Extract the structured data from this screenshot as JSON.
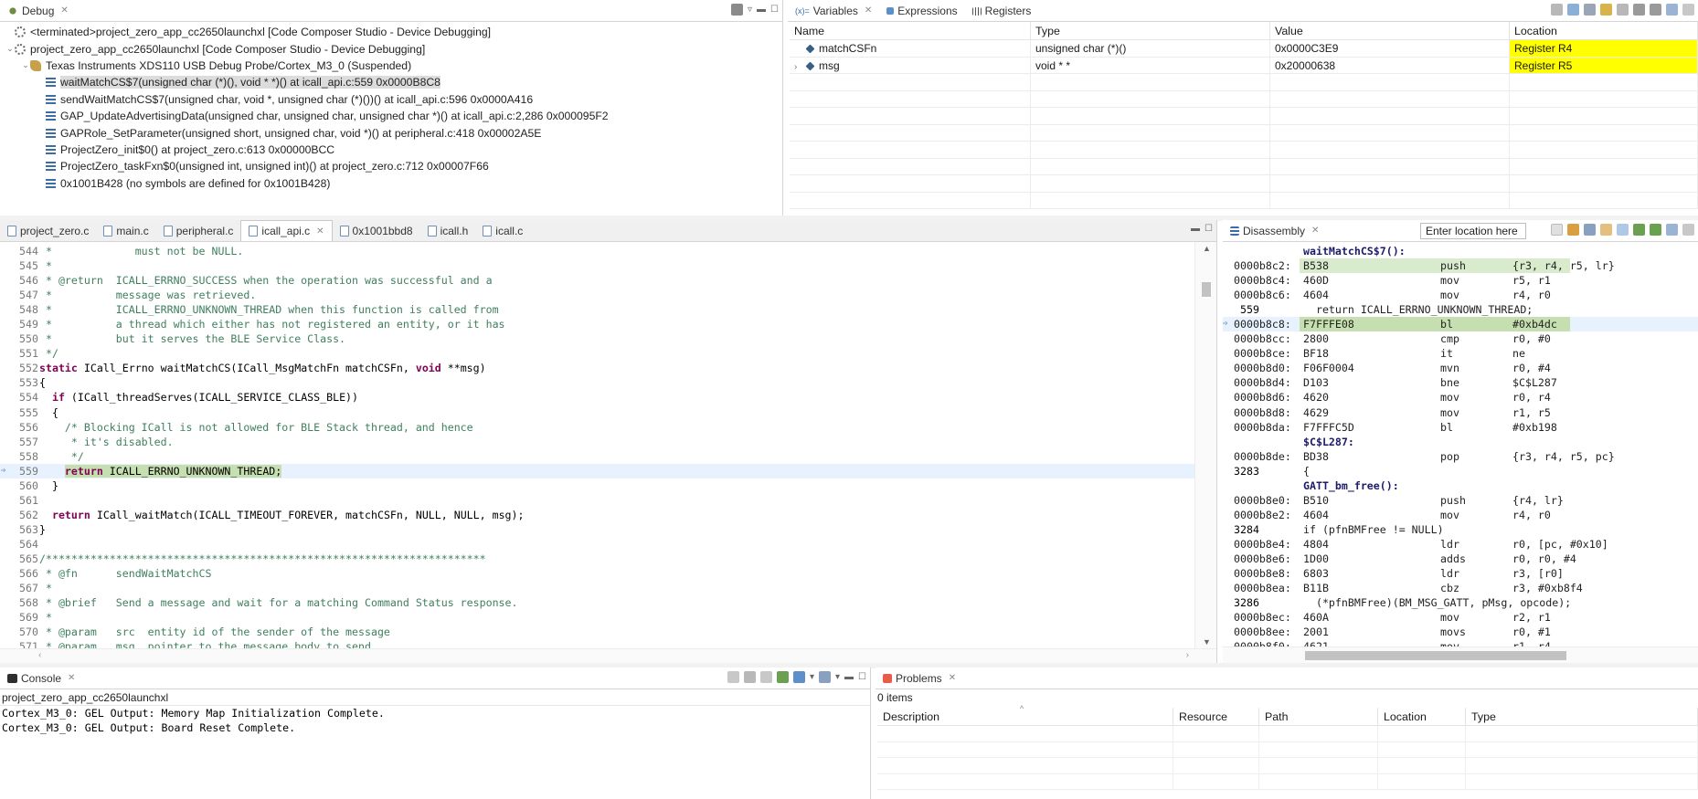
{
  "debug_view": {
    "tab_label": "Debug",
    "rows": [
      {
        "indent": 0,
        "twist": "",
        "icon": "gear",
        "text": "<terminated>project_zero_app_cc2650launchxl [Code Composer Studio - Device Debugging]"
      },
      {
        "indent": 0,
        "twist": "v",
        "icon": "gear",
        "text": "project_zero_app_cc2650launchxl [Code Composer Studio - Device Debugging]"
      },
      {
        "indent": 1,
        "twist": "v",
        "icon": "probe",
        "text": "Texas Instruments XDS110 USB Debug Probe/Cortex_M3_0 (Suspended)"
      },
      {
        "indent": 2,
        "twist": "",
        "icon": "stack",
        "text": "waitMatchCS$7(unsigned char (*)(), void * *)() at icall_api.c:559 0x0000B8C8",
        "selected": true
      },
      {
        "indent": 2,
        "twist": "",
        "icon": "stack",
        "text": "sendWaitMatchCS$7(unsigned char, void *, unsigned char (*)())() at icall_api.c:596 0x0000A416"
      },
      {
        "indent": 2,
        "twist": "",
        "icon": "stack",
        "text": "GAP_UpdateAdvertisingData(unsigned char, unsigned char, unsigned char *)() at icall_api.c:2,286 0x000095F2"
      },
      {
        "indent": 2,
        "twist": "",
        "icon": "stack",
        "text": "GAPRole_SetParameter(unsigned short, unsigned char, void *)() at peripheral.c:418 0x00002A5E"
      },
      {
        "indent": 2,
        "twist": "",
        "icon": "stack",
        "text": "ProjectZero_init$0() at project_zero.c:613 0x00000BCC"
      },
      {
        "indent": 2,
        "twist": "",
        "icon": "stack",
        "text": "ProjectZero_taskFxn$0(unsigned int, unsigned int)() at project_zero.c:712 0x00007F66"
      },
      {
        "indent": 2,
        "twist": "",
        "icon": "stack",
        "text": "0x1001B428  (no symbols are defined for 0x1001B428)"
      }
    ]
  },
  "variables_view": {
    "tabs": [
      "Variables",
      "Expressions",
      "Registers"
    ],
    "tab_prefix": "(x)=",
    "columns": [
      "Name",
      "Type",
      "Value",
      "Location"
    ],
    "rows": [
      {
        "twist": "",
        "name": "matchCSFn",
        "type": "unsigned char (*)()",
        "value": "0x0000C3E9",
        "location": "Register R4"
      },
      {
        "twist": ">",
        "name": "msg",
        "type": "void * *",
        "value": "0x20000638",
        "location": "Register R5"
      }
    ],
    "highlight_color": "#ffff00"
  },
  "editor": {
    "tabs": [
      {
        "label": "project_zero.c",
        "active": false
      },
      {
        "label": "main.c",
        "active": false
      },
      {
        "label": "peripheral.c",
        "active": false
      },
      {
        "label": "icall_api.c",
        "active": true
      },
      {
        "label": "0x1001bbd8",
        "active": false
      },
      {
        "label": "icall.h",
        "active": false
      },
      {
        "label": "icall.c",
        "active": false
      }
    ],
    "lines": [
      {
        "n": "544",
        "code": " *             must not be NULL.",
        "kind": "comment"
      },
      {
        "n": "545",
        "code": " *",
        "kind": "comment"
      },
      {
        "n": "546",
        "code": " * @return  ICALL_ERRNO_SUCCESS when the operation was successful and a",
        "kind": "comment"
      },
      {
        "n": "547",
        "code": " *          message was retrieved.",
        "kind": "comment"
      },
      {
        "n": "548",
        "code": " *          ICALL_ERRNO_UNKNOWN_THREAD when this function is called from",
        "kind": "comment"
      },
      {
        "n": "549",
        "code": " *          a thread which either has not registered an entity, or it has",
        "kind": "comment"
      },
      {
        "n": "550",
        "code": " *          but it serves the BLE Service Class.",
        "kind": "comment"
      },
      {
        "n": "551",
        "code": " */",
        "kind": "comment"
      },
      {
        "n": "552",
        "code": "static ICall_Errno waitMatchCS(ICall_MsgMatchFn matchCSFn, void **msg)",
        "kind": "sig"
      },
      {
        "n": "553",
        "code": "{",
        "kind": "code"
      },
      {
        "n": "554",
        "code": "  if (ICall_threadServes(ICALL_SERVICE_CLASS_BLE))",
        "kind": "if"
      },
      {
        "n": "555",
        "code": "  {",
        "kind": "code"
      },
      {
        "n": "556",
        "code": "    /* Blocking ICall is not allowed for BLE Stack thread, and hence",
        "kind": "comment"
      },
      {
        "n": "557",
        "code": "     * it's disabled.",
        "kind": "comment"
      },
      {
        "n": "558",
        "code": "     */",
        "kind": "comment"
      },
      {
        "n": "559",
        "code": "    return ICALL_ERRNO_UNKNOWN_THREAD;",
        "kind": "current"
      },
      {
        "n": "560",
        "code": "  }",
        "kind": "code"
      },
      {
        "n": "561",
        "code": "",
        "kind": "code"
      },
      {
        "n": "562",
        "code": "  return ICall_waitMatch(ICALL_TIMEOUT_FOREVER, matchCSFn, NULL, NULL, msg);",
        "kind": "return"
      },
      {
        "n": "563",
        "code": "}",
        "kind": "code"
      },
      {
        "n": "564",
        "code": "",
        "kind": "code"
      },
      {
        "n": "565",
        "code": "/*********************************************************************",
        "kind": "comment"
      },
      {
        "n": "566",
        "code": " * @fn      sendWaitMatchCS",
        "kind": "comment"
      },
      {
        "n": "567",
        "code": " *",
        "kind": "comment"
      },
      {
        "n": "568",
        "code": " * @brief   Send a message and wait for a matching Command Status response.",
        "kind": "comment"
      },
      {
        "n": "569",
        "code": " *",
        "kind": "comment"
      },
      {
        "n": "570",
        "code": " * @param   src  entity id of the sender of the message",
        "kind": "comment"
      },
      {
        "n": "571",
        "code": " * @param   msg  pointer to the message body to send.",
        "kind": "comment"
      }
    ]
  },
  "disassembly": {
    "tab_label": "Disassembly",
    "location_placeholder": "Enter location here",
    "lines": [
      {
        "t": "label",
        "a": "",
        "o": "waitMatchCS$7():",
        "m": "",
        "r": ""
      },
      {
        "t": "ins",
        "a": "0000b8c2:",
        "o": "B538",
        "m": "push",
        "r": "{r3, r4, r5, lr}",
        "hl": true
      },
      {
        "t": "ins",
        "a": "0000b8c4:",
        "o": "460D",
        "m": "mov",
        "r": "r5, r1"
      },
      {
        "t": "ins",
        "a": "0000b8c6:",
        "o": "4604",
        "m": "mov",
        "r": "r4, r0"
      },
      {
        "t": "src",
        "a": " 559",
        "o": "  return ICALL_ERRNO_UNKNOWN_THREAD;",
        "m": "",
        "r": ""
      },
      {
        "t": "ins",
        "a": "0000b8c8:",
        "o": "F7FFFE08",
        "m": "bl",
        "r": "#0xb4dc",
        "cur": true
      },
      {
        "t": "ins",
        "a": "0000b8cc:",
        "o": "2800",
        "m": "cmp",
        "r": "r0, #0"
      },
      {
        "t": "ins",
        "a": "0000b8ce:",
        "o": "BF18",
        "m": "it",
        "r": "ne"
      },
      {
        "t": "ins",
        "a": "0000b8d0:",
        "o": "F06F0004",
        "m": "mvn",
        "r": "r0, #4"
      },
      {
        "t": "ins",
        "a": "0000b8d4:",
        "o": "D103",
        "m": "bne",
        "r": "$C$L287"
      },
      {
        "t": "ins",
        "a": "0000b8d6:",
        "o": "4620",
        "m": "mov",
        "r": "r0, r4"
      },
      {
        "t": "ins",
        "a": "0000b8d8:",
        "o": "4629",
        "m": "mov",
        "r": "r1, r5"
      },
      {
        "t": "ins",
        "a": "0000b8da:",
        "o": "F7FFFC5D",
        "m": "bl",
        "r": "#0xb198"
      },
      {
        "t": "label",
        "a": "",
        "o": "$C$L287:",
        "m": "",
        "r": ""
      },
      {
        "t": "ins",
        "a": "0000b8de:",
        "o": "BD38",
        "m": "pop",
        "r": "{r3, r4, r5, pc}"
      },
      {
        "t": "src",
        "a": "3283",
        "o": "{",
        "m": "",
        "r": ""
      },
      {
        "t": "label",
        "a": "",
        "o": "GATT_bm_free():",
        "m": "",
        "r": ""
      },
      {
        "t": "ins",
        "a": "0000b8e0:",
        "o": "B510",
        "m": "push",
        "r": "{r4, lr}"
      },
      {
        "t": "ins",
        "a": "0000b8e2:",
        "o": "4604",
        "m": "mov",
        "r": "r4, r0"
      },
      {
        "t": "src",
        "a": "3284",
        "o": "if (pfnBMFree != NULL)",
        "m": "",
        "r": ""
      },
      {
        "t": "ins",
        "a": "0000b8e4:",
        "o": "4804",
        "m": "ldr",
        "r": "r0, [pc, #0x10]"
      },
      {
        "t": "ins",
        "a": "0000b8e6:",
        "o": "1D00",
        "m": "adds",
        "r": "r0, r0, #4"
      },
      {
        "t": "ins",
        "a": "0000b8e8:",
        "o": "6803",
        "m": "ldr",
        "r": "r3, [r0]"
      },
      {
        "t": "ins",
        "a": "0000b8ea:",
        "o": "B11B",
        "m": "cbz",
        "r": "r3, #0xb8f4"
      },
      {
        "t": "src",
        "a": "3286",
        "o": "  (*pfnBMFree)(BM_MSG_GATT, pMsg, opcode);",
        "m": "",
        "r": ""
      },
      {
        "t": "ins",
        "a": "0000b8ec:",
        "o": "460A",
        "m": "mov",
        "r": "r2, r1"
      },
      {
        "t": "ins",
        "a": "0000b8ee:",
        "o": "2001",
        "m": "movs",
        "r": "r0, #1"
      },
      {
        "t": "ins",
        "a": "0000b8f0:",
        "o": "4621",
        "m": "mov",
        "r": "r1, r4"
      }
    ]
  },
  "console": {
    "tab_label": "Console",
    "subtitle": "project_zero_app_cc2650launchxl",
    "lines": [
      "Cortex_M3_0: GEL Output: Memory Map Initialization Complete.",
      "Cortex_M3_0: GEL Output: Board Reset Complete."
    ]
  },
  "problems": {
    "tab_label": "Problems",
    "count": "0 items",
    "columns": [
      "Description",
      "Resource",
      "Path",
      "Location",
      "Type"
    ]
  },
  "colors": {
    "comment": "#3f7f5f",
    "keyword": "#7f0055",
    "current_line": "#e8f2fe",
    "current_instr": "#c6dfb0",
    "highlight": "#ffff00"
  }
}
